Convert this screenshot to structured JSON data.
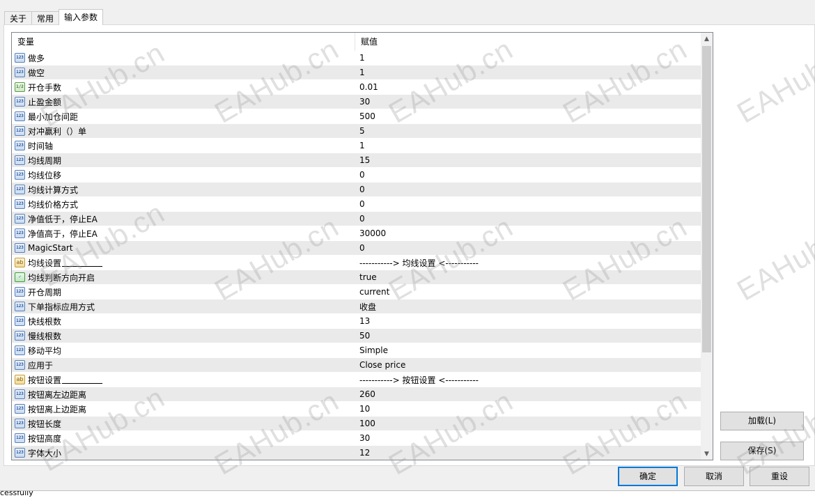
{
  "tabs": [
    {
      "label": "关于",
      "active": false
    },
    {
      "label": "常用",
      "active": false
    },
    {
      "label": "输入参数",
      "active": true
    }
  ],
  "grid": {
    "headers": {
      "variable": "变量",
      "value": "赋值"
    },
    "rows": [
      {
        "icon": "int",
        "name": "做多",
        "value": "1"
      },
      {
        "icon": "int",
        "name": "做空",
        "value": "1"
      },
      {
        "icon": "double",
        "name": "开仓手数",
        "value": "0.01"
      },
      {
        "icon": "int",
        "name": "止盈金额",
        "value": "30"
      },
      {
        "icon": "int",
        "name": "最小加仓间距",
        "value": "500"
      },
      {
        "icon": "int",
        "name": "对冲赢利（）单",
        "value": "5"
      },
      {
        "icon": "int",
        "name": "时间轴",
        "value": "1"
      },
      {
        "icon": "int",
        "name": "均线周期",
        "value": "15"
      },
      {
        "icon": "int",
        "name": "均线位移",
        "value": "0"
      },
      {
        "icon": "int",
        "name": "均线计算方式",
        "value": "0"
      },
      {
        "icon": "int",
        "name": "均线价格方式",
        "value": "0"
      },
      {
        "icon": "int",
        "name": "净值低于，停止EA",
        "value": "0"
      },
      {
        "icon": "int",
        "name": "净值高于，停止EA",
        "value": "30000"
      },
      {
        "icon": "int",
        "name": "MagicStart",
        "value": "0"
      },
      {
        "icon": "string",
        "name": "均线设置",
        "value": "-----------> 均线设置 <-----------",
        "underline": true
      },
      {
        "icon": "bool",
        "name": "均线判断方向开启",
        "value": "true"
      },
      {
        "icon": "int",
        "name": "开仓周期",
        "value": "current"
      },
      {
        "icon": "int",
        "name": "下单指标应用方式",
        "value": "收盘"
      },
      {
        "icon": "int",
        "name": "快线根数",
        "value": "13"
      },
      {
        "icon": "int",
        "name": "慢线根数",
        "value": "50"
      },
      {
        "icon": "int",
        "name": "移动平均",
        "value": "Simple"
      },
      {
        "icon": "int",
        "name": "应用于",
        "value": "Close price"
      },
      {
        "icon": "string",
        "name": "按钮设置",
        "value": "-----------> 按钮设置 <-----------",
        "underline": true
      },
      {
        "icon": "int",
        "name": "按钮离左边距离",
        "value": "260"
      },
      {
        "icon": "int",
        "name": "按钮离上边距离",
        "value": "10"
      },
      {
        "icon": "int",
        "name": "按钮长度",
        "value": "100"
      },
      {
        "icon": "int",
        "name": "按钮高度",
        "value": "30"
      },
      {
        "icon": "int",
        "name": "字体大小",
        "value": "12"
      }
    ]
  },
  "icon_glyphs": {
    "int": "123",
    "double": "1/2",
    "string": "ab",
    "bool": "✓"
  },
  "buttons": {
    "load": "加载(L)",
    "save": "保存(S)",
    "ok": "确定",
    "cancel": "取消",
    "reset": "重设"
  },
  "watermark": "EAHub.cn",
  "status": "cessfully",
  "colors": {
    "row_alt": "#eaeaea",
    "accent": "#0078d7"
  }
}
